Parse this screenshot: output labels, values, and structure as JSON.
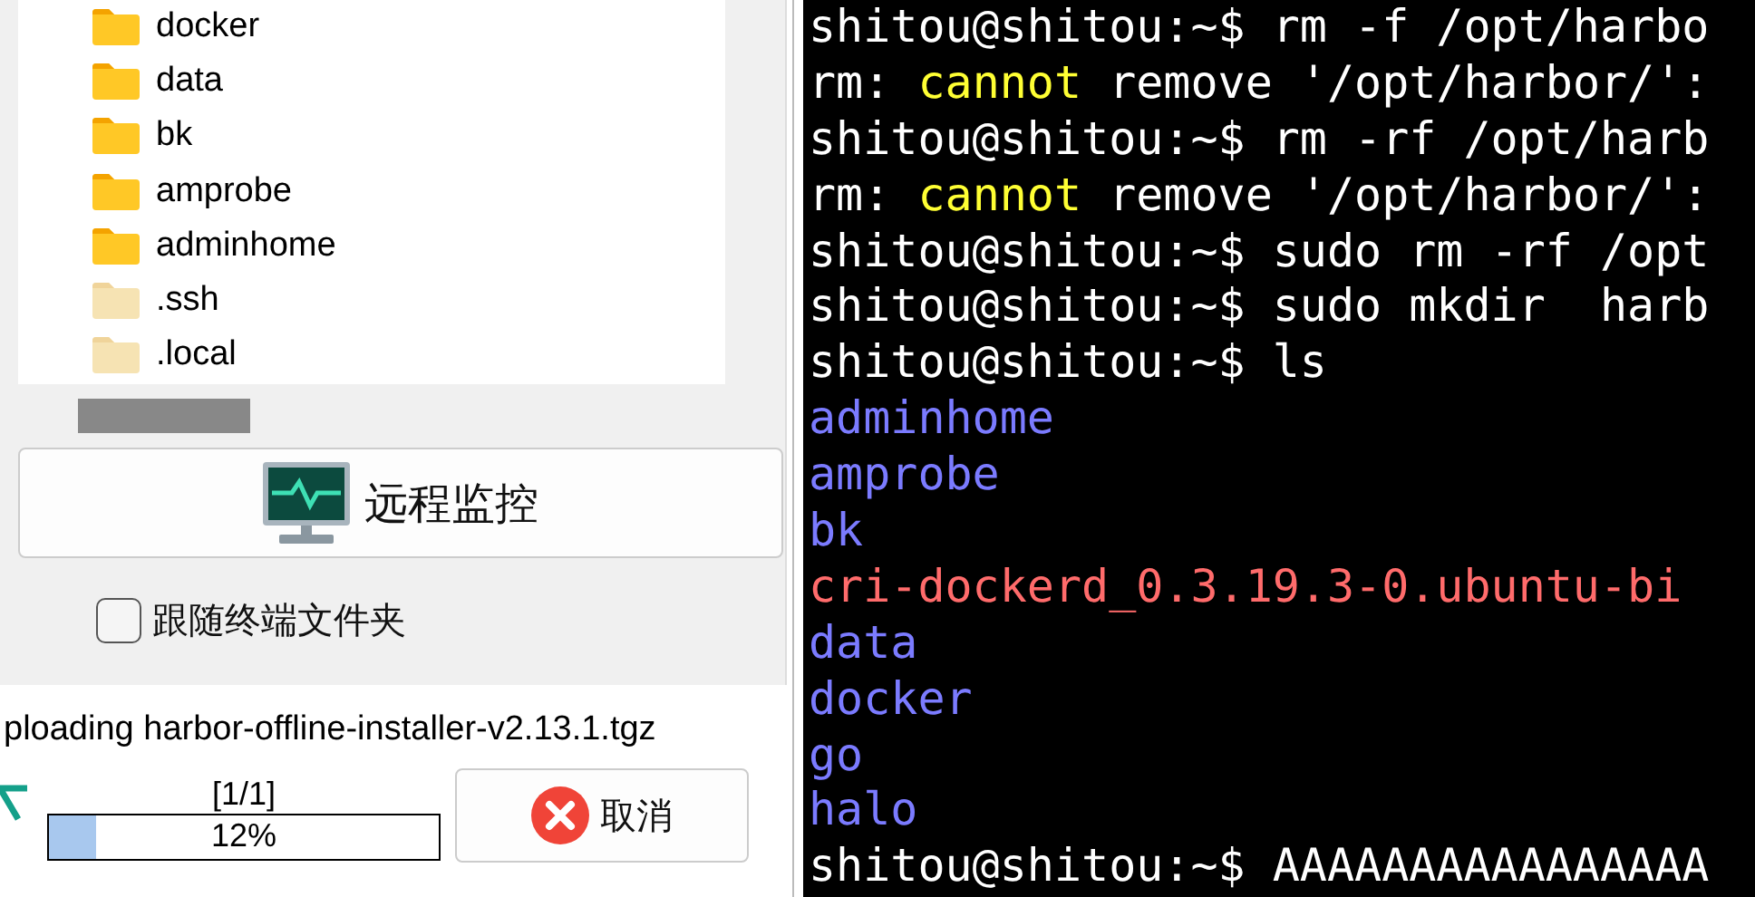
{
  "file_list": {
    "items": [
      {
        "name": "docker",
        "hidden": false
      },
      {
        "name": "data",
        "hidden": false
      },
      {
        "name": "bk",
        "hidden": false
      },
      {
        "name": "amprobe",
        "hidden": false
      },
      {
        "name": "adminhome",
        "hidden": false
      },
      {
        "name": ".ssh",
        "hidden": true
      },
      {
        "name": ".local",
        "hidden": true
      }
    ]
  },
  "monitor_button": {
    "label": "远程监控"
  },
  "follow_checkbox": {
    "label": "跟随终端文件夹",
    "checked": false
  },
  "transfer": {
    "status": "ploading harbor-offline-installer-v2.13.1.tgz",
    "count": "[1/1]",
    "level": 0.12,
    "percent": "12%",
    "cancel": "取消"
  },
  "terminal": {
    "lines": [
      {
        "segments": [
          {
            "text": "shitou@shitou:~$ rm -f /opt/harbo",
            "color": "#ffffff"
          }
        ]
      },
      {
        "segments": [
          {
            "text": "rm: ",
            "color": "#ffffff"
          },
          {
            "text": "cannot",
            "color": "#ffff33"
          },
          {
            "text": " remove '/opt/harbor/':",
            "color": "#ffffff"
          }
        ]
      },
      {
        "segments": [
          {
            "text": "shitou@shitou:~$ rm -rf /opt/harb",
            "color": "#ffffff"
          }
        ]
      },
      {
        "segments": [
          {
            "text": "rm: ",
            "color": "#ffffff"
          },
          {
            "text": "cannot",
            "color": "#ffff33"
          },
          {
            "text": " remove '/opt/harbor/':",
            "color": "#ffffff"
          }
        ]
      },
      {
        "segments": [
          {
            "text": "shitou@shitou:~$ sudo rm -rf /opt",
            "color": "#ffffff"
          }
        ]
      },
      {
        "segments": [
          {
            "text": "shitou@shitou:~$ sudo mkdir  harb",
            "color": "#ffffff"
          }
        ]
      },
      {
        "segments": [
          {
            "text": "shitou@shitou:~$ ls",
            "color": "#ffffff"
          }
        ]
      },
      {
        "segments": [
          {
            "text": "adminhome",
            "color": "#7b7bff"
          }
        ]
      },
      {
        "segments": [
          {
            "text": "amprobe",
            "color": "#7b7bff"
          }
        ]
      },
      {
        "segments": [
          {
            "text": "bk",
            "color": "#7b7bff"
          }
        ]
      },
      {
        "segments": [
          {
            "text": "cri-dockerd_0.3.19.3-0.ubuntu-bi",
            "color": "#ff6b6b"
          }
        ]
      },
      {
        "segments": [
          {
            "text": "data",
            "color": "#7b7bff"
          }
        ]
      },
      {
        "segments": [
          {
            "text": "docker",
            "color": "#7b7bff"
          }
        ]
      },
      {
        "segments": [
          {
            "text": "go",
            "color": "#7b7bff"
          }
        ]
      },
      {
        "segments": [
          {
            "text": "halo",
            "color": "#7b7bff"
          }
        ]
      },
      {
        "segments": [
          {
            "text": "shitou@shitou:~$ AAAAAAAAAAAAAAAA",
            "color": "#ffffff"
          }
        ]
      }
    ]
  }
}
